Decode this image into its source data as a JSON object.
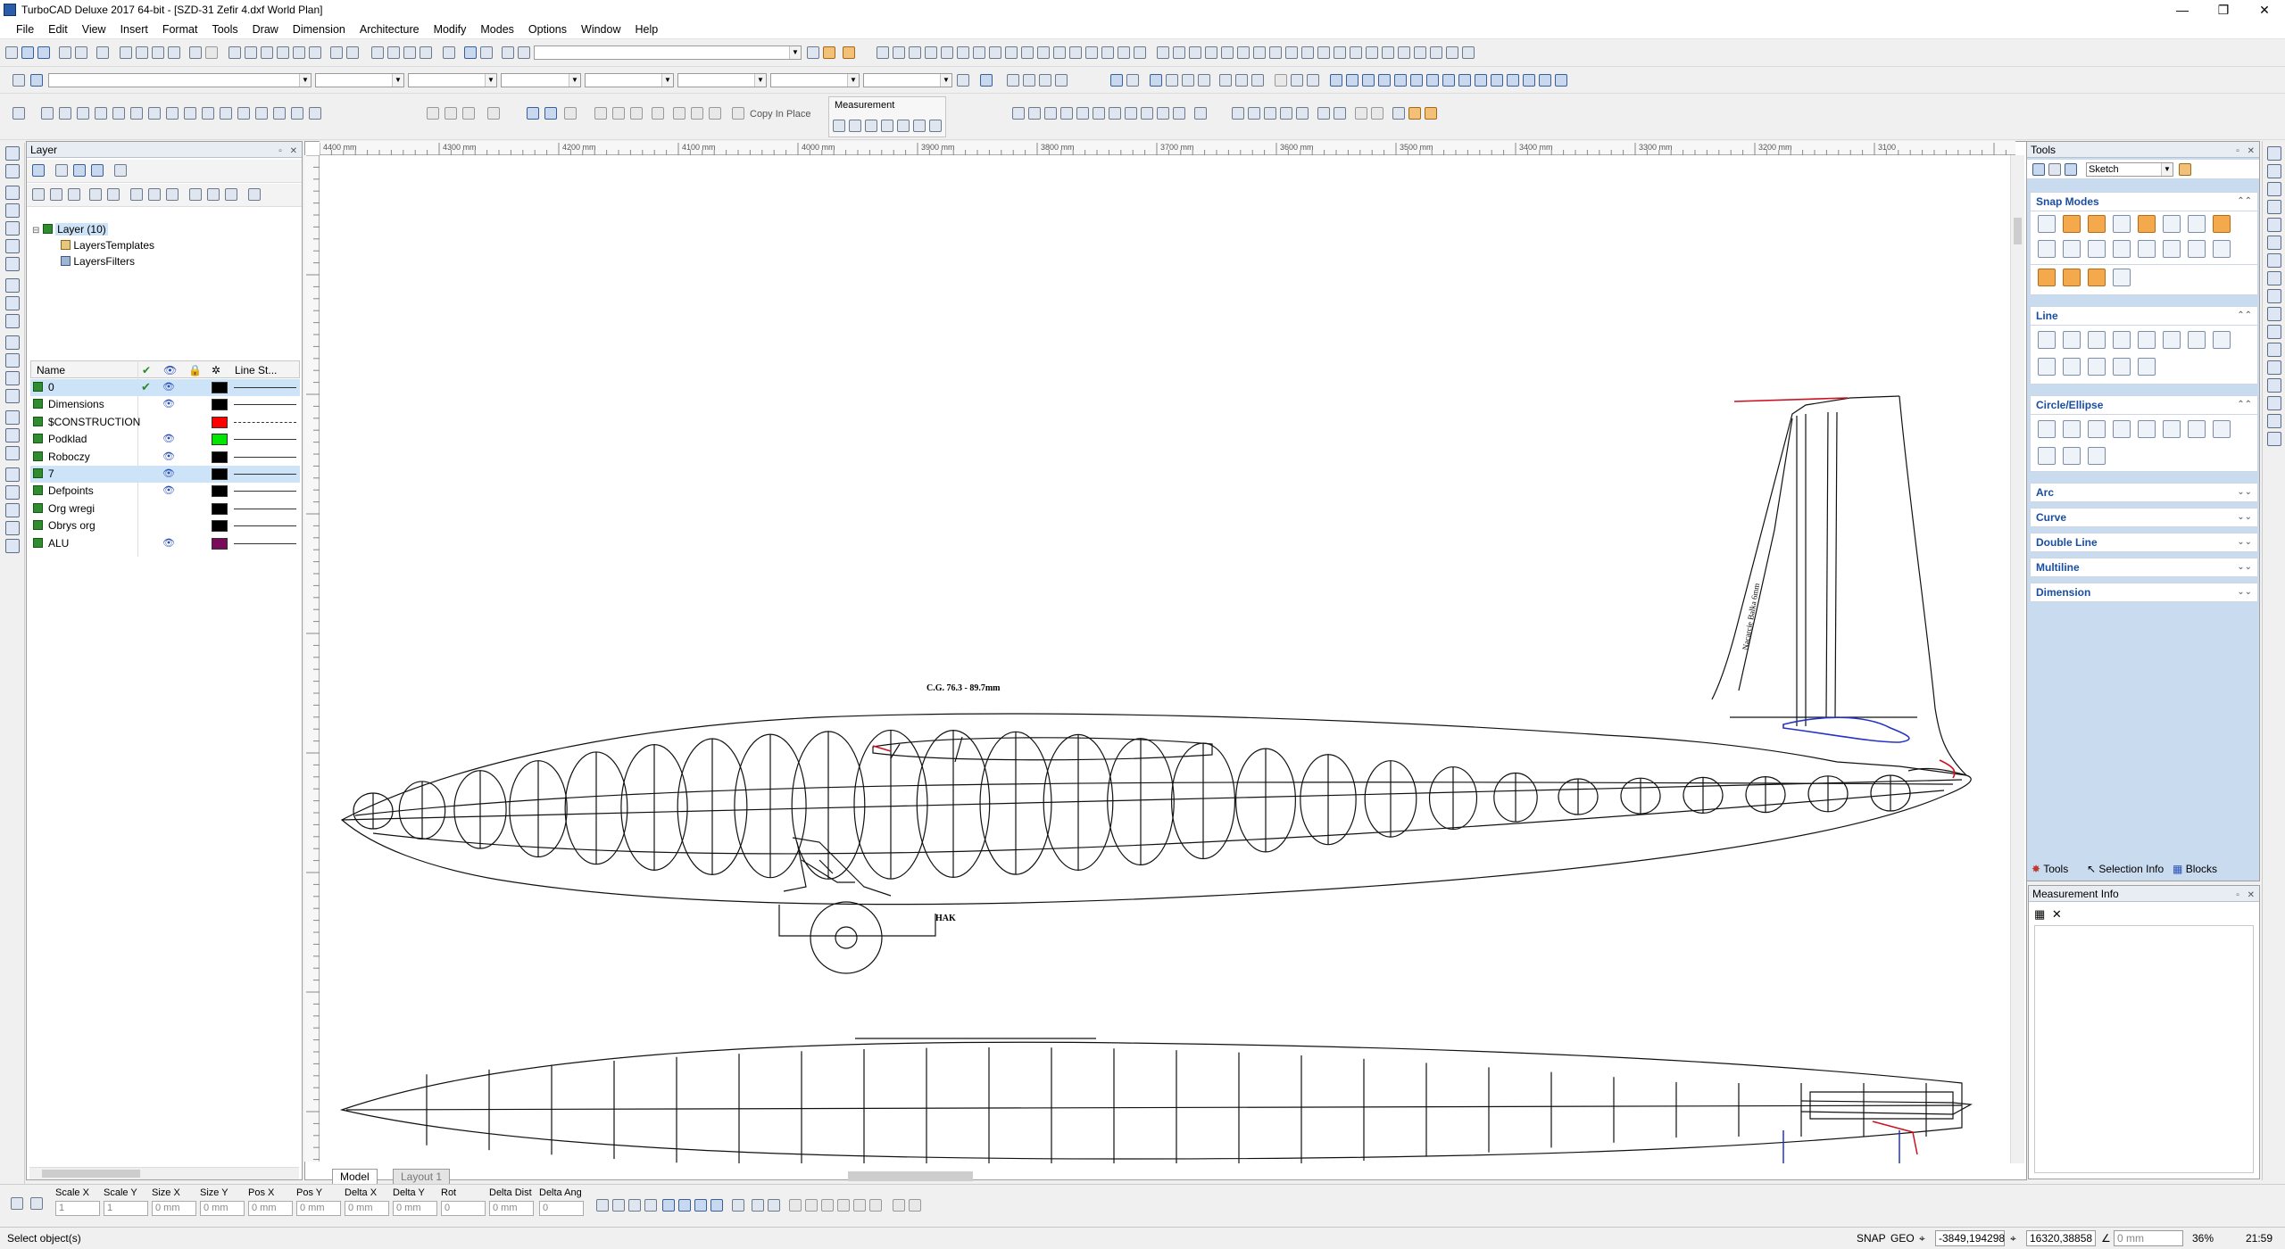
{
  "window": {
    "title": "TurboCAD Deluxe 2017 64-bit - [SZD-31 Zefir 4.dxf World Plan]",
    "minimize_glyph": "—",
    "restore_glyph": "❐",
    "close_glyph": "✕"
  },
  "menu": [
    "File",
    "Edit",
    "View",
    "Insert",
    "Format",
    "Tools",
    "Draw",
    "Dimension",
    "Architecture",
    "Modify",
    "Modes",
    "Options",
    "Window",
    "Help"
  ],
  "toolbar": {
    "copy_in_place": "Copy In Place",
    "measurement_label": "Measurement"
  },
  "layer_panel": {
    "title": "Layer",
    "tree": {
      "root": "Layer (10)",
      "children": [
        "LayersTemplates",
        "LayersFilters"
      ]
    },
    "columns": {
      "name": "Name",
      "line_style": "Line St..."
    },
    "rows": [
      {
        "name": "0",
        "active": true,
        "visible": true,
        "color": "#000000",
        "style": "solid"
      },
      {
        "name": "Dimensions",
        "active": false,
        "visible": true,
        "color": "#000000",
        "style": "solid"
      },
      {
        "name": "$CONSTRUCTION",
        "active": false,
        "visible": false,
        "color": "#ff0000",
        "style": "dashdot"
      },
      {
        "name": "Podklad",
        "active": false,
        "visible": true,
        "color": "#00e600",
        "style": "solid"
      },
      {
        "name": "Roboczy",
        "active": false,
        "visible": true,
        "color": "#000000",
        "style": "solid"
      },
      {
        "name": "7",
        "active": false,
        "visible": true,
        "color": "#000000",
        "style": "solid"
      },
      {
        "name": "Defpoints",
        "active": false,
        "visible": true,
        "color": "#000000",
        "style": "solid"
      },
      {
        "name": "Org wregi",
        "active": false,
        "visible": false,
        "color": "#000000",
        "style": "solid"
      },
      {
        "name": "Obrys org",
        "active": false,
        "visible": false,
        "color": "#000000",
        "style": "solid"
      },
      {
        "name": "ALU",
        "active": false,
        "visible": true,
        "color": "#7a0a5a",
        "style": "solid"
      }
    ]
  },
  "drawing": {
    "cg_label": "C.G. 76.3 - 89.7mm",
    "hook_label": "HAK",
    "fin_label": "Nacarcie Balka 6mm",
    "ruler_top": [
      "4400 mm",
      "4300 mm",
      "4200 mm",
      "4100 mm",
      "4000 mm",
      "3900 mm",
      "3800 mm",
      "3700 mm",
      "3600 mm",
      "3500 mm",
      "3400 mm",
      "3300 mm",
      "3200 mm",
      "3100"
    ]
  },
  "canvas_tabs": {
    "model": "Model",
    "layout": "Layout 1"
  },
  "tools_panel": {
    "title": "Tools",
    "mode": "Sketch",
    "sections": [
      {
        "title": "Snap Modes",
        "expanded": true
      },
      {
        "title": "Line",
        "expanded": true
      },
      {
        "title": "Circle/Ellipse",
        "expanded": true
      },
      {
        "title": "Arc",
        "expanded": false
      },
      {
        "title": "Curve",
        "expanded": false
      },
      {
        "title": "Double Line",
        "expanded": false
      },
      {
        "title": "Multiline",
        "expanded": false
      },
      {
        "title": "Dimension",
        "expanded": false
      }
    ],
    "bottom_tabs": [
      "Tools",
      "Selection Info",
      "Blocks"
    ]
  },
  "measurement_panel": {
    "title": "Measurement Info"
  },
  "inspector": {
    "fields": [
      {
        "label": "Scale X",
        "value": "1"
      },
      {
        "label": "Scale Y",
        "value": "1"
      },
      {
        "label": "Size X",
        "value": "0 mm"
      },
      {
        "label": "Size Y",
        "value": "0 mm"
      },
      {
        "label": "Pos X",
        "value": "0 mm"
      },
      {
        "label": "Pos Y",
        "value": "0 mm"
      },
      {
        "label": "Delta X",
        "value": "0 mm"
      },
      {
        "label": "Delta Y",
        "value": "0 mm"
      },
      {
        "label": "Rot",
        "value": "0"
      },
      {
        "label": "Delta Dist",
        "value": "0 mm"
      },
      {
        "label": "Delta Ang",
        "value": "0"
      }
    ]
  },
  "status": {
    "message": "Select object(s)",
    "snap": "SNAP",
    "geo": "GEO",
    "coord_x": "-3849,194298",
    "coord_y": "16320,38858",
    "distance": "0 mm",
    "zoom": "36%",
    "time": "21:59"
  }
}
